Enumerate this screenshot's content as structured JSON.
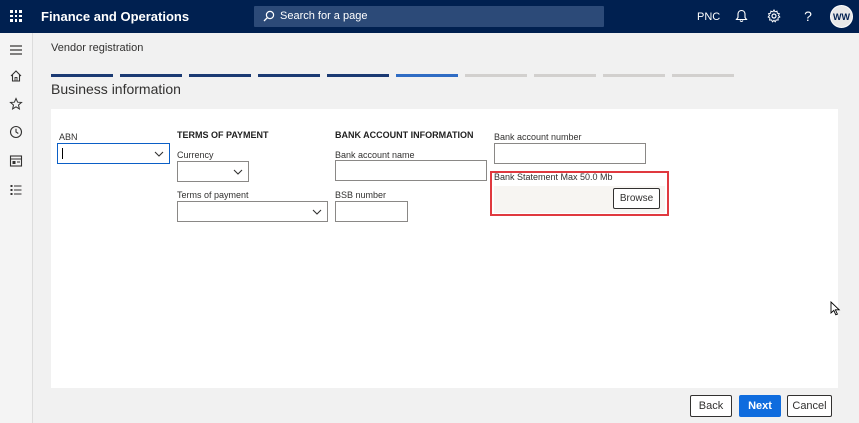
{
  "topbar": {
    "app_title": "Finance and Operations",
    "search_placeholder": "Search for a page",
    "company": "PNC",
    "avatar_initials": "WW",
    "icons": [
      "app-launcher-icon",
      "search-icon",
      "bell-icon",
      "gear-icon",
      "help-icon"
    ]
  },
  "leftnav": {
    "icons": [
      "hamburger-icon",
      "home-icon",
      "star-icon",
      "clock-icon",
      "workspace-icon",
      "list-icon"
    ]
  },
  "page": {
    "breadcrumb": "Vendor registration",
    "section_title": "Business information",
    "progress": {
      "total_steps": 10,
      "completed_steps": 5,
      "current_step": 6
    }
  },
  "form": {
    "abn": {
      "label": "ABN",
      "value": ""
    },
    "terms_header": "TERMS OF PAYMENT",
    "currency": {
      "label": "Currency",
      "value": ""
    },
    "terms_of_payment": {
      "label": "Terms of payment",
      "value": ""
    },
    "bank_header": "BANK ACCOUNT INFORMATION",
    "bank_account_name": {
      "label": "Bank account name",
      "value": ""
    },
    "bsb_number": {
      "label": "BSB number",
      "value": ""
    },
    "bank_account_number": {
      "label": "Bank account number",
      "value": ""
    },
    "bank_statement": {
      "label": "Bank Statement Max 50.0 Mb",
      "browse_label": "Browse"
    }
  },
  "footer": {
    "back_label": "Back",
    "next_label": "Next",
    "cancel_label": "Cancel"
  },
  "colors": {
    "topbar": "#002050",
    "step_done": "#1b3a73",
    "step_current": "#2f6cc4",
    "step_todo": "#d2d0ce",
    "primary": "#0f6cde",
    "highlight": "#e0393f"
  }
}
